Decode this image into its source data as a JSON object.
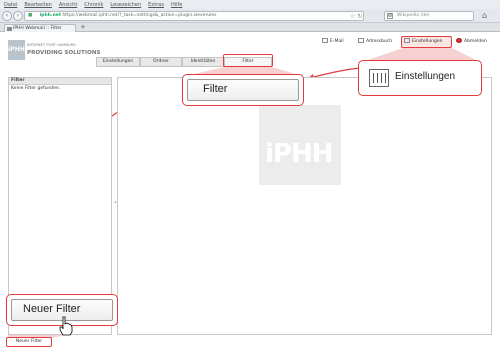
{
  "browser": {
    "menu": [
      "Datei",
      "Bearbeiten",
      "Ansicht",
      "Chronik",
      "Lesezeichen",
      "Extras",
      "Hilfe"
    ],
    "url_host": "iphh.net",
    "url_full": "https://webmail.iphh.net/?_task=settings&_action=plugin.sieverules",
    "search_placeholder": "Wikipedia (de)",
    "tab_title": "IPHH Webmail :: Filter"
  },
  "app": {
    "logo_line1": "INTERNET PORT HAMBURG",
    "logo_line2": "PROVIDING SOLUTIONS",
    "logo_mark": "iPHH",
    "topnav": {
      "mail": "E-Mail",
      "addressbook": "Adressbuch",
      "settings": "Einstellungen",
      "logout": "Abmelden"
    },
    "tabs": [
      "Einstellungen",
      "Ordner",
      "Identitäten",
      "Filter"
    ],
    "active_tab": "Filter",
    "filter_panel": {
      "header": "Filter",
      "empty": "Keine Filter gefunden."
    },
    "new_filter_button": "Neuer Filter",
    "watermark": "iPHH"
  },
  "callouts": {
    "filter": "Filter",
    "settings": "Einstellungen",
    "new_filter": "Neuer Filter"
  },
  "colors": {
    "highlight": "#e23c3c",
    "highlight_fill": "#f6c9c9"
  }
}
